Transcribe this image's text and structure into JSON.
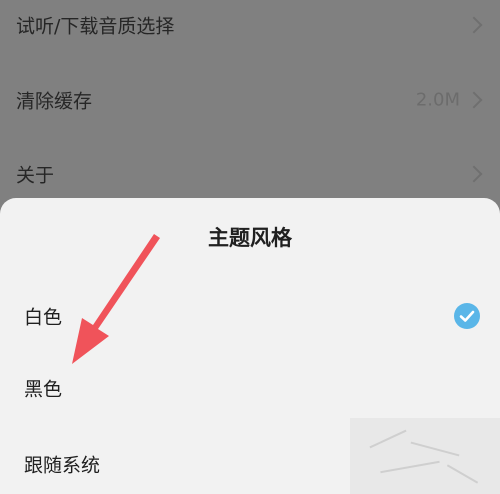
{
  "settings": {
    "rows": [
      {
        "label": "试听/下载音质选择",
        "value": ""
      },
      {
        "label": "清除缓存",
        "value": "2.0M"
      },
      {
        "label": "关于",
        "value": ""
      }
    ]
  },
  "theme_sheet": {
    "title": "主题风格",
    "options": [
      {
        "label": "白色",
        "selected": true
      },
      {
        "label": "黑色",
        "selected": false
      },
      {
        "label": "跟随系统",
        "selected": false
      }
    ]
  },
  "colors": {
    "check_accent": "#5ab6e8",
    "annotation_arrow": "#f0535a"
  }
}
